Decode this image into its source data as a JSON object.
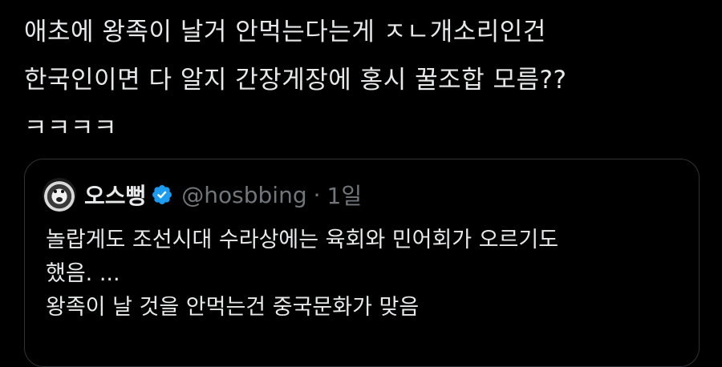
{
  "tweet": {
    "lines": [
      "애초에 왕족이 날거 안먹는다는게 ㅈㄴ개소리인건",
      "한국인이면 다 알지 간장게장에 홍시 꿀조합 모름??",
      "ㅋㅋㅋㅋ"
    ]
  },
  "quote": {
    "display_name": "오스뻥",
    "handle": "@hosbbing",
    "separator": "·",
    "time": "1일",
    "lines": [
      "놀랍게도 조선시대 수라상에는 육회와 민어회가 오르기도",
      "했음. ...",
      "왕족이 날 것을 안먹는건 중국문화가 맞음"
    ]
  },
  "colors": {
    "background": "#000000",
    "text": "#e7e9ea",
    "secondary": "#71767b",
    "border": "#2f3336",
    "verified": "#1d9bf0"
  },
  "icons": {
    "verified": "verified-badge-icon",
    "avatar": "user-avatar"
  }
}
